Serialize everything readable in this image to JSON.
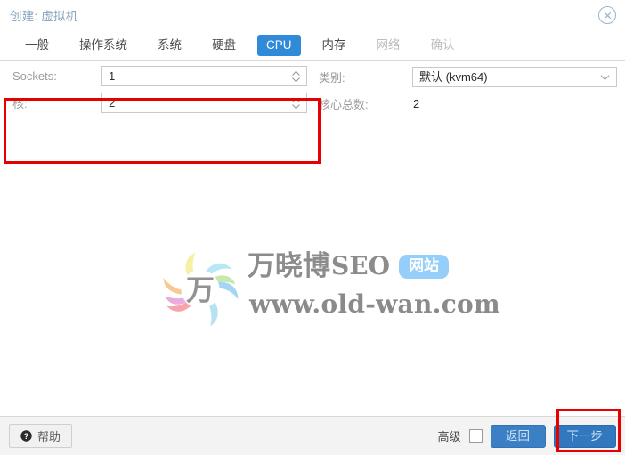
{
  "window": {
    "title": "创建: 虚拟机",
    "close_icon": "close-circle-icon"
  },
  "tabs": [
    {
      "label": "一般",
      "state": "normal"
    },
    {
      "label": "操作系统",
      "state": "normal"
    },
    {
      "label": "系统",
      "state": "normal"
    },
    {
      "label": "硬盘",
      "state": "normal"
    },
    {
      "label": "CPU",
      "state": "active"
    },
    {
      "label": "内存",
      "state": "normal"
    },
    {
      "label": "网络",
      "state": "disabled"
    },
    {
      "label": "确认",
      "state": "disabled"
    }
  ],
  "form": {
    "left": {
      "sockets_label": "Sockets:",
      "sockets_value": "1",
      "cores_label": "核:",
      "cores_value": "2"
    },
    "right": {
      "type_label": "类别:",
      "type_value": "默认 (kvm64)",
      "total_cores_label": "核心总数:",
      "total_cores_value": "2"
    }
  },
  "watermark": {
    "brand_cn": "万晓博",
    "brand_en": "SEO",
    "badge": "网站",
    "url": "www.old-wan.com",
    "logo_icon": "pinwheel-logo-icon",
    "logo_char": "万"
  },
  "footer": {
    "help_label": "帮助",
    "help_icon": "question-mark-icon",
    "advanced_label": "高级",
    "advanced_checked": false,
    "back_label": "返回",
    "next_label": "下一步"
  },
  "annotations": {
    "highlight_color": "#e60000",
    "boxes": [
      {
        "name": "cpu-socket-core-fields",
        "target": "form-left"
      },
      {
        "name": "next-step-button",
        "target": "footer-next"
      }
    ]
  },
  "colors": {
    "accent_blue": "#2f8ad8",
    "button_blue": "#3b7fc4",
    "title_text": "#8aa4bd",
    "highlight_red": "#e60000"
  }
}
